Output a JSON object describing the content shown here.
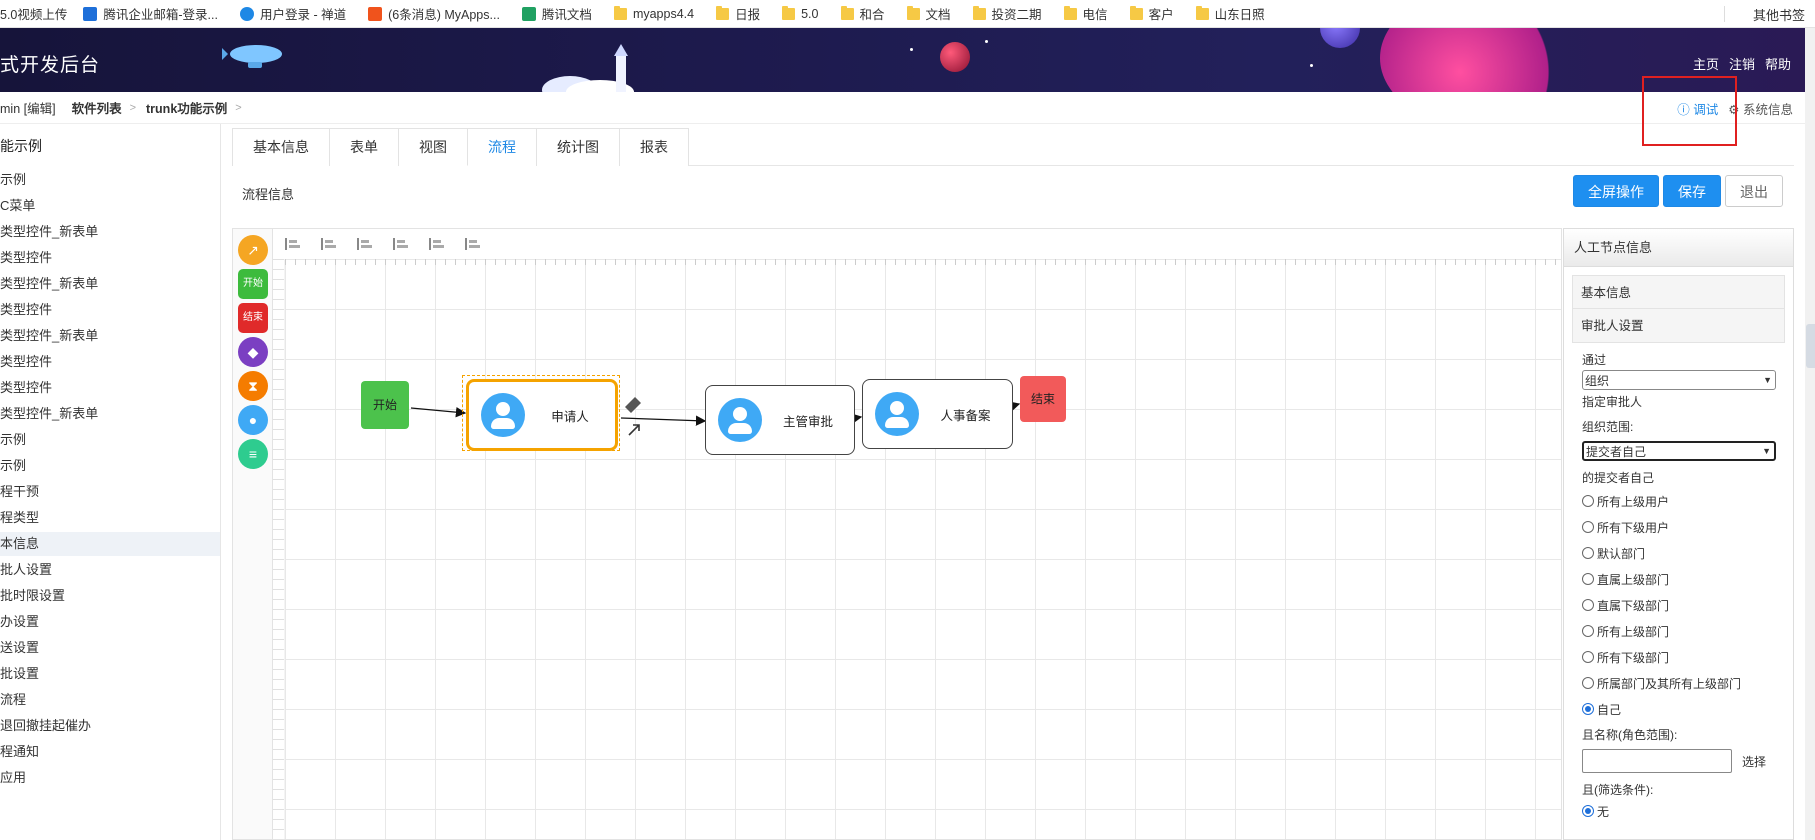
{
  "bookmarks": {
    "items": [
      {
        "label": "5.0视频上传",
        "icon": "folder-icon"
      },
      {
        "label": "腾讯企业邮箱-登录...",
        "icon": "mail-icon",
        "color": "#1e6fd9"
      },
      {
        "label": "用户登录 - 禅道",
        "icon": "zentao-icon",
        "color": "#1e88e5"
      },
      {
        "label": "(6条消息) MyApps...",
        "icon": "csdn-icon",
        "color": "#f0531c"
      },
      {
        "label": "腾讯文档",
        "icon": "doc-icon",
        "color": "#20a162"
      },
      {
        "label": "myapps4.4",
        "icon": "folder-icon"
      },
      {
        "label": "日报",
        "icon": "folder-icon"
      },
      {
        "label": "5.0",
        "icon": "folder-icon"
      },
      {
        "label": "和合",
        "icon": "folder-icon"
      },
      {
        "label": "文档",
        "icon": "folder-icon"
      },
      {
        "label": "投资二期",
        "icon": "folder-icon"
      },
      {
        "label": "电信",
        "icon": "folder-icon"
      },
      {
        "label": "客户",
        "icon": "folder-icon"
      },
      {
        "label": "山东日照",
        "icon": "folder-icon"
      }
    ],
    "other": "其他书签"
  },
  "banner": {
    "title": "式开发后台",
    "links": [
      "主页",
      "注销",
      "帮助"
    ]
  },
  "breadcrumb": {
    "user": "min [编辑]",
    "items": [
      "软件列表",
      "trunk功能示例"
    ],
    "debug": "调试",
    "sysinfo": "系统信息"
  },
  "sidebar": {
    "title": "能示例",
    "items": [
      "示例",
      "C菜单",
      "类型控件_新表单",
      "类型控件",
      "类型控件_新表单",
      "类型控件",
      "类型控件_新表单",
      "类型控件",
      "类型控件",
      "类型控件_新表单",
      "示例",
      "示例",
      "程干预",
      "程类型",
      "本信息",
      "批人设置",
      "批时限设置",
      "办设置",
      "送设置",
      "批设置",
      "流程",
      "退回撤挂起催办",
      "程通知",
      "应用"
    ],
    "active_index": 14
  },
  "tabs": [
    "基本信息",
    "表单",
    "视图",
    "流程",
    "统计图",
    "报表"
  ],
  "active_tab": 3,
  "flow": {
    "label": "流程信息",
    "buttons": {
      "fullscreen": "全屏操作",
      "save": "保存",
      "exit": "退出"
    }
  },
  "palette": {
    "items": [
      {
        "name": "arrow-tool-icon",
        "text": "",
        "color": "#f5a623"
      },
      {
        "name": "start-tool",
        "text": "开始",
        "color": "#3dbb3d"
      },
      {
        "name": "end-tool",
        "text": "结束",
        "color": "#e02a2a"
      },
      {
        "name": "diamond-tool-icon",
        "text": "",
        "color": "#7b3fc2"
      },
      {
        "name": "hourglass-tool-icon",
        "text": "",
        "color": "#f57c00"
      },
      {
        "name": "user-tool-icon",
        "text": "",
        "color": "#3fa9f5"
      },
      {
        "name": "sliders-tool-icon",
        "text": "",
        "color": "#2ecc8f"
      }
    ]
  },
  "diagram": {
    "start": "开始",
    "applicant": "申请人",
    "manager": "主管审批",
    "hr": "人事备案",
    "end": "结束"
  },
  "panel": {
    "title": "人工节点信息",
    "sections": [
      "基本信息",
      "审批人设置"
    ],
    "pass_label": "通过",
    "pass_select": "组织",
    "designate_label": "指定审批人",
    "scope_label": "组织范围:",
    "scope_select": "提交者自己",
    "submitter_label": "的提交者自己",
    "options": [
      "所有上级用户",
      "所有下级用户",
      "默认部门",
      "直属上级部门",
      "直属下级部门",
      "所有上级部门",
      "所有下级部门",
      "所属部门及其所有上级部门",
      "自己"
    ],
    "selected_option": 8,
    "role_label": "且名称(角色范围):",
    "choose_label": "选择",
    "filter_label": "且(筛选条件):",
    "filter_option": "无"
  }
}
